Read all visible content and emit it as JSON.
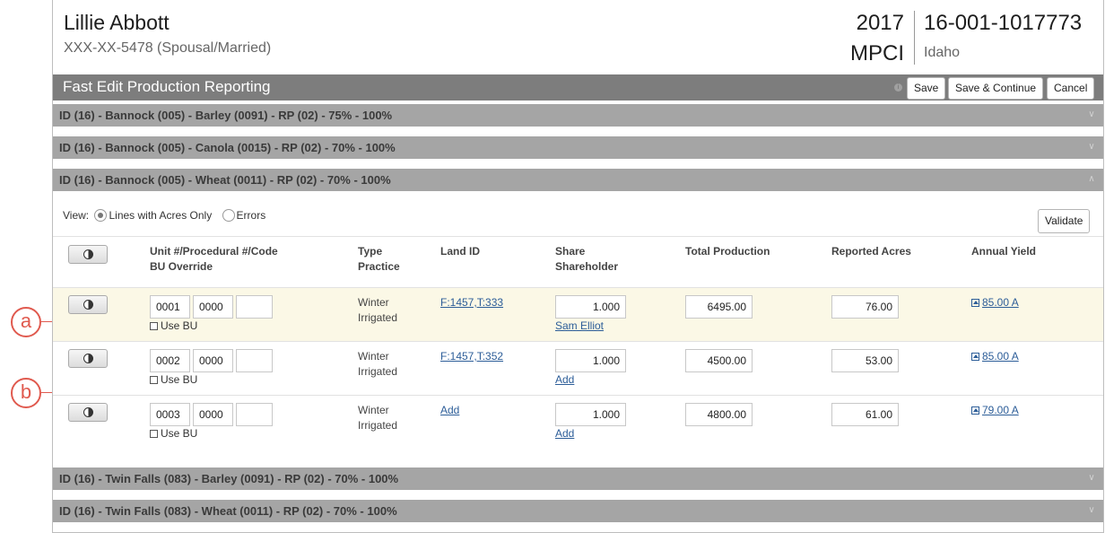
{
  "callouts": {
    "a": "a",
    "b": "b"
  },
  "header": {
    "name": "Lillie Abbott",
    "ssn": "XXX-XX-5478 (Spousal/Married)",
    "year": "2017",
    "plan": "MPCI",
    "policy_number": "16-001-1017773",
    "state": "Idaho"
  },
  "titlebar": {
    "title": "Fast Edit Production Reporting",
    "save": "Save",
    "save_continue": "Save & Continue",
    "cancel": "Cancel"
  },
  "sections": [
    {
      "title": "ID (16) - Bannock (005) - Barley (0091) - RP (02) - 75% - 100%",
      "expanded": false
    },
    {
      "title": "ID (16) - Bannock (005) - Canola (0015) - RP (02) - 70% - 100%",
      "expanded": false
    },
    {
      "title": "ID (16) - Bannock (005) - Wheat (0011) - RP (02) - 70% - 100%",
      "expanded": true
    },
    {
      "title": "ID (16) - Twin Falls (083) - Barley (0091) - RP (02) - 70% - 100%",
      "expanded": false
    },
    {
      "title": "ID (16) - Twin Falls (083) - Wheat (0011) - RP (02) - 70% - 100%",
      "expanded": false
    }
  ],
  "view": {
    "label": "View:",
    "option_acres": "Lines with Acres Only",
    "option_errors": "Errors",
    "selected": "Lines with Acres Only",
    "validate": "Validate"
  },
  "columns": {
    "unit_1": "Unit #/Procedural #/Code",
    "unit_2": "BU Override",
    "type_1": "Type",
    "type_2": "Practice",
    "land": "Land ID",
    "share_1": "Share",
    "share_2": "Shareholder",
    "production": "Total Production",
    "acres": "Reported Acres",
    "yield": "Annual Yield"
  },
  "rows": [
    {
      "unit": "0001",
      "procedural": "0000",
      "code": "",
      "use_bu": "Use BU",
      "type": "Winter",
      "practice": "Irrigated",
      "land_id": "F:1457,T:333",
      "share": "1.000",
      "shareholder": "Sam Elliot",
      "production": "6495.00",
      "acres": "76.00",
      "yield": "85.00 A"
    },
    {
      "unit": "0002",
      "procedural": "0000",
      "code": "",
      "use_bu": "Use BU",
      "type": "Winter",
      "practice": "Irrigated",
      "land_id": "F:1457,T:352",
      "share": "1.000",
      "shareholder": "Add",
      "production": "4500.00",
      "acres": "53.00",
      "yield": "85.00 A"
    },
    {
      "unit": "0003",
      "procedural": "0000",
      "code": "",
      "use_bu": "Use BU",
      "type": "Winter",
      "practice": "Irrigated",
      "land_id": "Add",
      "share": "1.000",
      "shareholder": "Add",
      "production": "4800.00",
      "acres": "61.00",
      "yield": "79.00 A"
    }
  ]
}
